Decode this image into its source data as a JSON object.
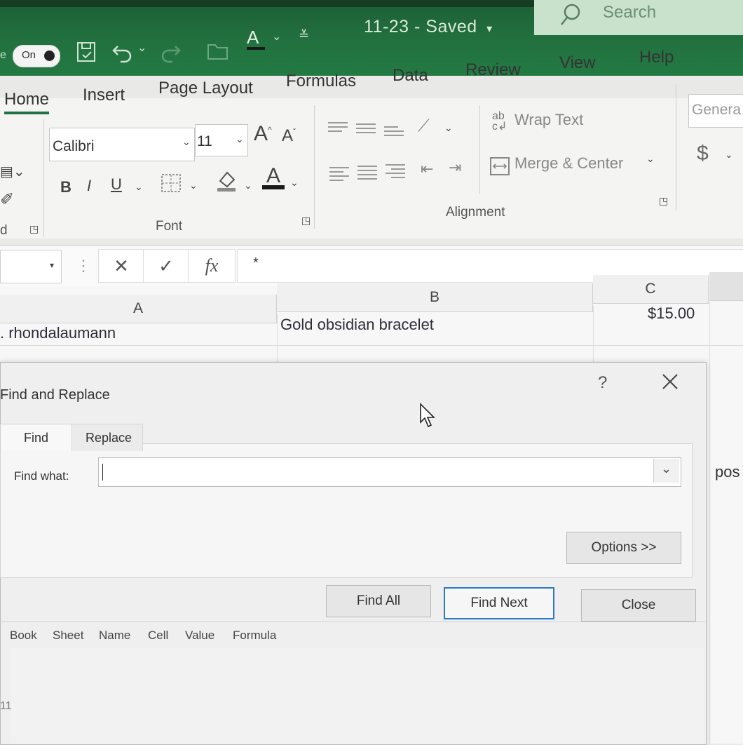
{
  "titlebar": {
    "autosave_prefix": "e",
    "autosave_state": "On",
    "document_title": "11-23 - Saved",
    "search_placeholder": "Search"
  },
  "ribbon_tabs": [
    "Home",
    "Insert",
    "Page Layout",
    "Formulas",
    "Data",
    "Review",
    "View",
    "Help"
  ],
  "ribbon": {
    "font_name": "Calibri",
    "font_size": "11",
    "bold": "B",
    "italic": "I",
    "underline": "U",
    "font_group_label": "Font",
    "clipboard_label_partial": "d",
    "wrap_text": "Wrap Text",
    "merge_center": "Merge & Center",
    "alignment_group_label": "Alignment",
    "number_format_partial": "Genera",
    "currency_symbol": "$",
    "font_grow": "A",
    "font_shrink": "A",
    "font_color_glyph": "A",
    "wrap_icon_glyph": "ab"
  },
  "formula_bar": {
    "cancel_glyph": "✕",
    "enter_glyph": "✓",
    "fx_glyph": "fx",
    "content": "*"
  },
  "sheet": {
    "columns": [
      "A",
      "B",
      "C"
    ],
    "row1": {
      "a": ". rhondalaumann",
      "b": "Gold obsidian bracelet",
      "c": "$15.00"
    },
    "right_edge_text": "pos",
    "row_number_partial": "11"
  },
  "dialog": {
    "title": "Find and Replace",
    "help": "?",
    "tabs": [
      "Find",
      "Replace"
    ],
    "find_what_label": "Find what:",
    "find_what_value": "",
    "options_button": "Options >>",
    "find_all_button": "Find All",
    "find_next_button": "Find Next",
    "close_button": "Close",
    "result_columns": [
      "Book",
      "Sheet",
      "Name",
      "Cell",
      "Value",
      "Formula"
    ]
  },
  "colors": {
    "titlebar_green": "#217346",
    "search_bg": "#c9e2cb",
    "default_button_border": "#2a79c9"
  }
}
